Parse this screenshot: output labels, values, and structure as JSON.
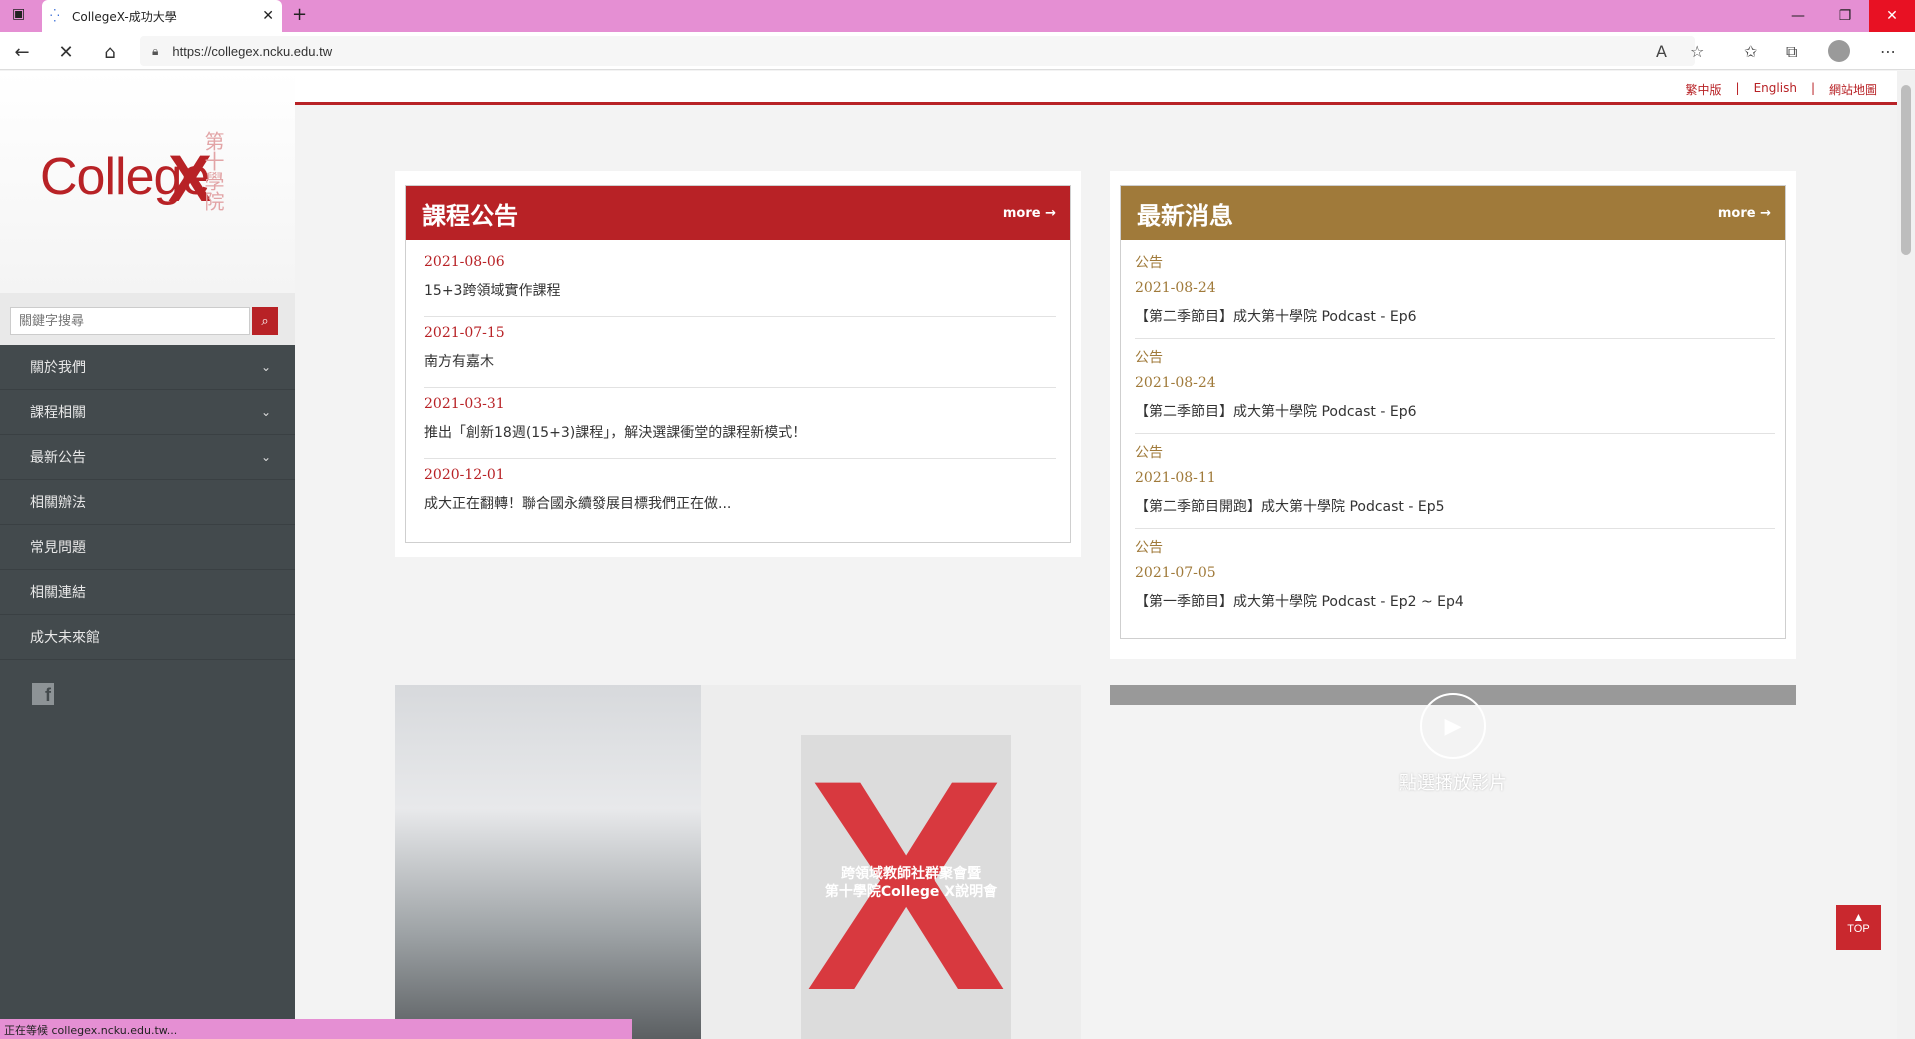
{
  "browser": {
    "tab_title": "CollegeX-成功大學",
    "url": "https://collegex.ncku.edu.tw",
    "status_text": "正在等候 collegex.ncku.edu.tw..."
  },
  "header": {
    "links": [
      "繁中版",
      "English",
      "網站地圖"
    ]
  },
  "sidebar": {
    "logo_text": "College",
    "logo_x": "X",
    "logo_chars": "第十學院",
    "search_placeholder": "關鍵字搜尋",
    "items": [
      {
        "label": "關於我們",
        "has_submenu": true
      },
      {
        "label": "課程相關",
        "has_submenu": true
      },
      {
        "label": "最新公告",
        "has_submenu": true
      },
      {
        "label": "相關辦法",
        "has_submenu": false
      },
      {
        "label": "常見問題",
        "has_submenu": false
      },
      {
        "label": "相關連結",
        "has_submenu": false
      },
      {
        "label": "成大未來館",
        "has_submenu": false
      }
    ]
  },
  "course_announcements": {
    "title": "課程公告",
    "more": "more →",
    "color": "#b82226",
    "items": [
      {
        "date": "2021-08-06",
        "title": "15+3跨領域實作課程"
      },
      {
        "date": "2021-07-15",
        "title": "南方有嘉木"
      },
      {
        "date": "2021-03-31",
        "title": "推出「創新18週(15+3)課程」，解決選課衝堂的課程新模式！"
      },
      {
        "date": "2020-12-01",
        "title": "成大正在翻轉！聯合國永續發展目標我們正在做..."
      }
    ]
  },
  "latest_news": {
    "title": "最新消息",
    "more": "more →",
    "color": "#a07a3a",
    "items": [
      {
        "category": "公告",
        "date": "2021-08-24",
        "title": "【第二季節目】成大第十學院 Podcast - Ep6"
      },
      {
        "category": "公告",
        "date": "2021-08-24",
        "title": "【第二季節目】成大第十學院 Podcast - Ep6"
      },
      {
        "category": "公告",
        "date": "2021-08-11",
        "title": "【第二季節目開跑】成大第十學院 Podcast - Ep5"
      },
      {
        "category": "公告",
        "date": "2021-07-05",
        "title": "【第一季節目】成大第十學院 Podcast - Ep2 ~ Ep4"
      }
    ]
  },
  "poster": {
    "line1": "跨領域教師社群聚會暨",
    "line2": "第十學院College X說明會"
  },
  "video": {
    "label": "點選播放影片"
  },
  "top_button": "TOP"
}
